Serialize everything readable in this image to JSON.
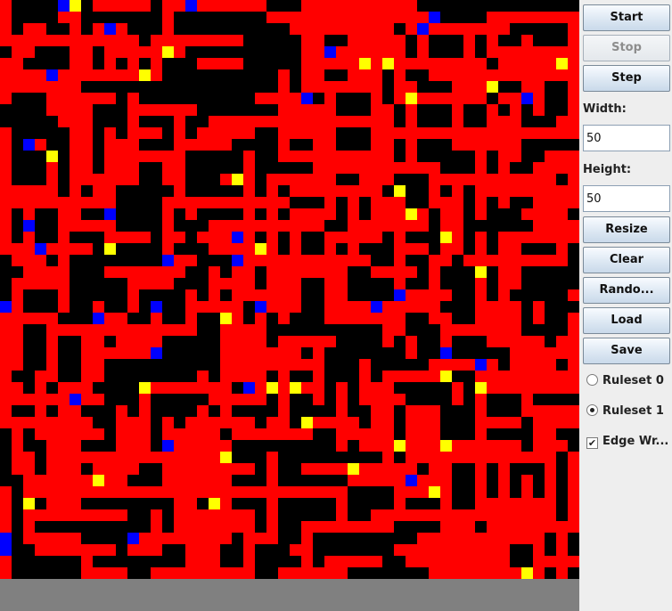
{
  "controls": {
    "start_label": "Start",
    "stop_label": "Stop",
    "step_label": "Step",
    "width_label": "Width:",
    "width_value": "50",
    "height_label": "Height:",
    "height_value": "50",
    "resize_label": "Resize",
    "clear_label": "Clear",
    "random_label": "Rando...",
    "load_label": "Load",
    "save_label": "Save",
    "ruleset0_label": "Ruleset 0",
    "ruleset1_label": "Ruleset 1",
    "edge_wrap_label": "Edge Wr...",
    "ruleset_selected": 1,
    "edge_wrap_checked": true,
    "stop_enabled": false
  },
  "grid": {
    "cols": 50,
    "rows": 50,
    "colors": {
      "dead": "#000000",
      "wire": "#ff0000",
      "head": "#0000ff",
      "tail": "#ffff00"
    }
  }
}
